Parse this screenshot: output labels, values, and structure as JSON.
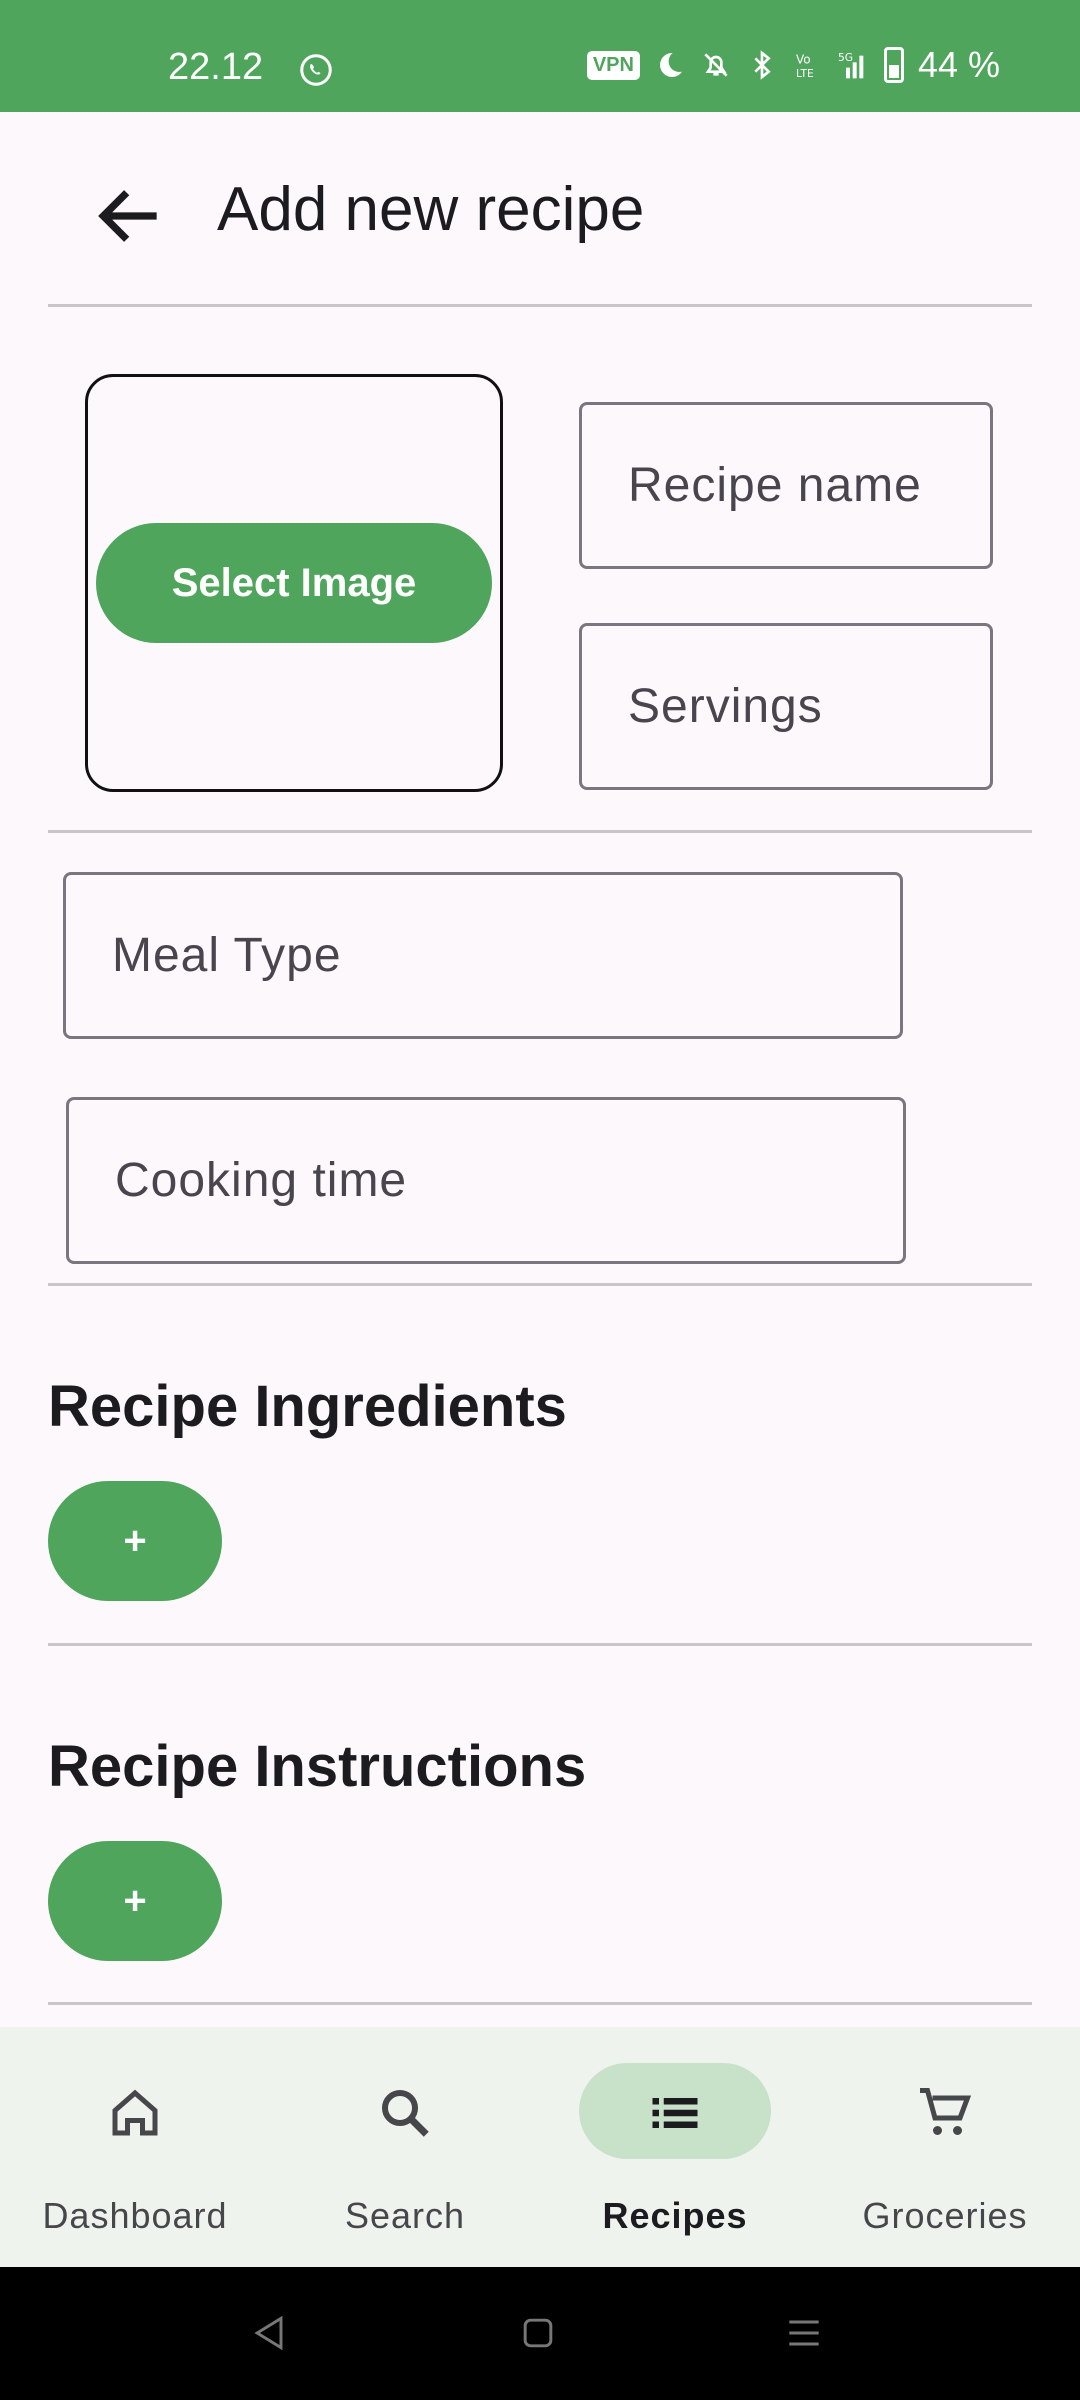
{
  "status_bar": {
    "time": "22.12",
    "vpn": "VPN",
    "battery": "44 %"
  },
  "appbar": {
    "title": "Add new recipe"
  },
  "form": {
    "select_image_label": "Select Image",
    "recipe_name_placeholder": "Recipe name",
    "servings_placeholder": "Servings",
    "meal_type_placeholder": "Meal Type",
    "cooking_time_placeholder": "Cooking time"
  },
  "sections": {
    "ingredients_title": "Recipe Ingredients",
    "ingredients_add": "+",
    "instructions_title": "Recipe Instructions",
    "instructions_add": "+"
  },
  "bottom_nav": {
    "items": [
      {
        "label": "Dashboard",
        "icon": "home-icon"
      },
      {
        "label": "Search",
        "icon": "search-icon"
      },
      {
        "label": "Recipes",
        "icon": "list-icon",
        "active": true
      },
      {
        "label": "Groceries",
        "icon": "cart-icon"
      }
    ]
  },
  "colors": {
    "accent": "#4fa55c",
    "active_pill": "#c7e2c9",
    "background": "#fdf8fc"
  }
}
